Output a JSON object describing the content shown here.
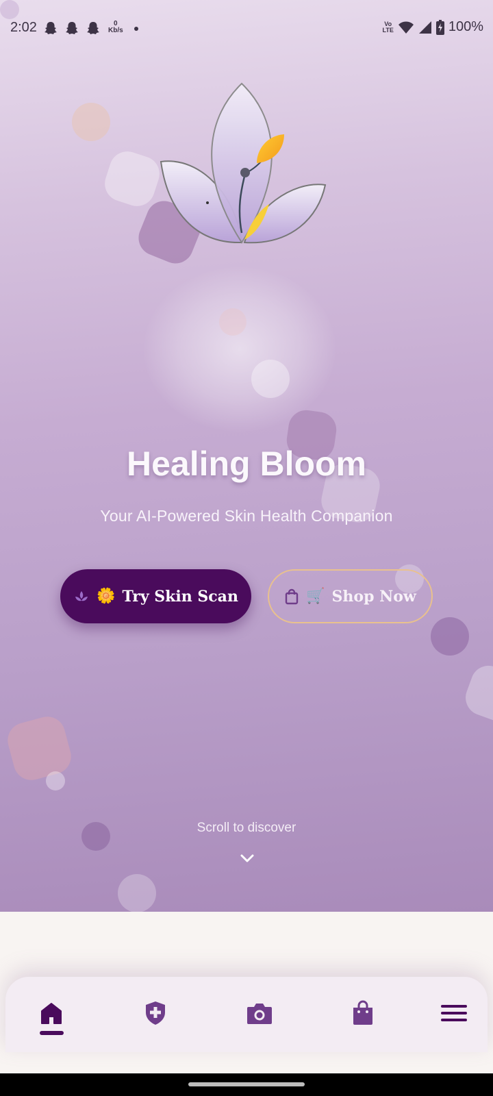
{
  "status_bar": {
    "time": "2:02",
    "net_speed_value": "0",
    "net_speed_unit": "Kb/s",
    "volte_top": "Vo",
    "volte_bottom": "LTE",
    "battery": "100%"
  },
  "hero": {
    "title": "Healing Bloom",
    "subtitle": "Your AI-Powered Skin Health Companion",
    "scan_button": {
      "emoji": "🌼",
      "label": "Try Skin Scan"
    },
    "shop_button": {
      "emoji": "🛒",
      "label": "Shop Now"
    },
    "scroll_hint": "Scroll to discover"
  },
  "bottom_nav": {
    "items": [
      {
        "icon": "home-icon",
        "active": true
      },
      {
        "icon": "shield-plus-icon",
        "active": false
      },
      {
        "icon": "camera-icon",
        "active": false
      },
      {
        "icon": "shopping-bag-icon",
        "active": false
      },
      {
        "icon": "menu-icon",
        "active": false
      }
    ]
  },
  "colors": {
    "primary": "#4a0b5c",
    "accent_border": "#e9c18d",
    "nav_icon": "#6f3d8a",
    "hero_bottom": "#a98bba"
  }
}
